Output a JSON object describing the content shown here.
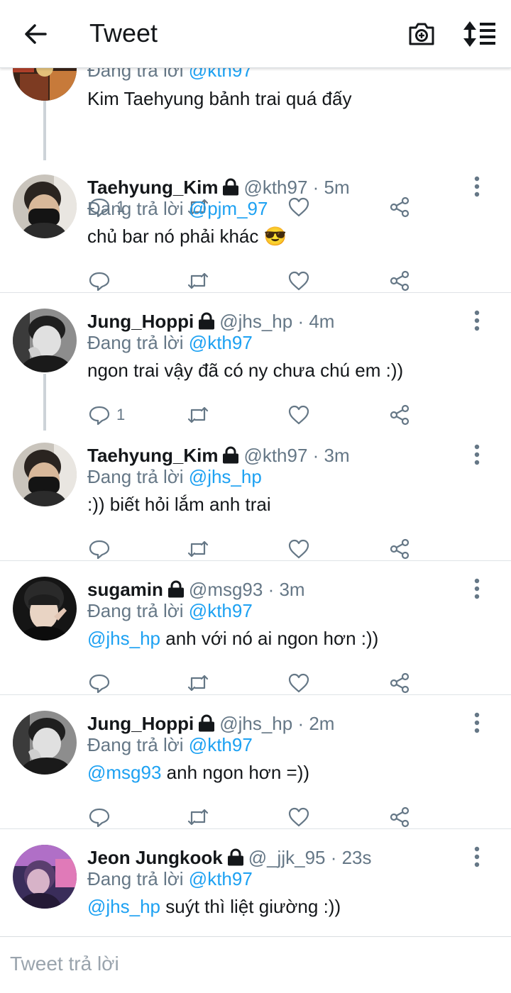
{
  "header": {
    "title": "Tweet"
  },
  "reply_prefix": "Đang trả lời",
  "first_tweet": {
    "reply_to": "@kth97",
    "text": "Kim Taehyung bảnh trai quá đấy",
    "reply_count": "1"
  },
  "tweets": [
    {
      "name": "Taehyung_Kim",
      "meta": "@kth97 · 5m",
      "reply_to": "@pjm_97",
      "mention": "",
      "text": "chủ bar nó phải khác 😎",
      "reply_count": ""
    },
    {
      "name": "Jung_Hoppi",
      "meta": "@jhs_hp · 4m",
      "reply_to": "@kth97",
      "mention": "",
      "text": "ngon trai vậy đã có ny chưa chú em :))",
      "reply_count": "1"
    },
    {
      "name": "Taehyung_Kim",
      "meta": "@kth97 · 3m",
      "reply_to": "@jhs_hp",
      "mention": "",
      "text": ":)) biết hỏi lắm anh trai",
      "reply_count": ""
    },
    {
      "name": "sugamin",
      "meta": "@msg93 · 3m",
      "reply_to": "@kth97",
      "mention": "@jhs_hp",
      "text": " anh với nó ai ngon hơn :))",
      "reply_count": ""
    },
    {
      "name": "Jung_Hoppi",
      "meta": "@jhs_hp · 2m",
      "reply_to": "@kth97",
      "mention": "@msg93",
      "text": " anh ngon hơn =))",
      "reply_count": ""
    },
    {
      "name": "Jeon Jungkook",
      "meta": "@_jjk_95 · 23s",
      "reply_to": "@kth97",
      "mention": "@jhs_hp",
      "text": " suýt thì liệt giường :))",
      "reply_count": ""
    }
  ],
  "composer": {
    "placeholder": "Tweet trả lời"
  },
  "colors": {
    "accent": "#1da1f2",
    "text": "#14171a",
    "muted": "#657786",
    "divider": "#dfe3e6"
  },
  "icons": [
    "back-arrow-icon",
    "camera-icon",
    "sort-icon",
    "lock-icon",
    "more-vertical-icon",
    "reply-icon",
    "retweet-icon",
    "like-icon",
    "share-icon"
  ]
}
